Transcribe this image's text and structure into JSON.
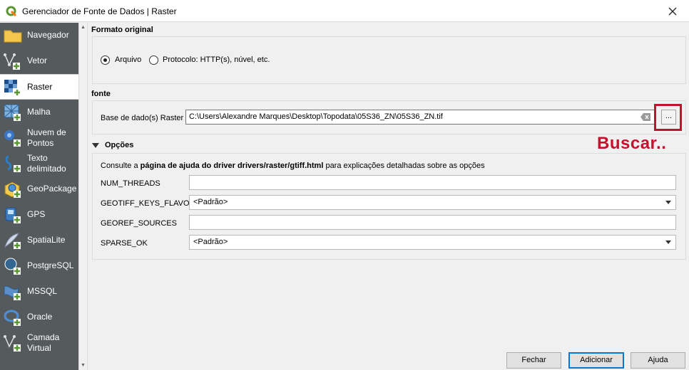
{
  "window": {
    "title": "Gerenciador de Fonte de Dados | Raster"
  },
  "sidebar": {
    "items": [
      {
        "label": "Navegador",
        "icon": "folder-icon"
      },
      {
        "label": "Vetor",
        "icon": "vector-icon"
      },
      {
        "label": "Raster",
        "icon": "raster-icon",
        "active": true
      },
      {
        "label": "Malha",
        "icon": "mesh-icon"
      },
      {
        "label": "Nuvem de Pontos",
        "line1": "Nuvem de",
        "line2": "Pontos",
        "icon": "point-cloud-icon"
      },
      {
        "label": "Texto delimitado",
        "line1": "Texto",
        "line2": "delimitado",
        "icon": "delimited-text-icon"
      },
      {
        "label": "GeoPackage",
        "icon": "geopackage-icon"
      },
      {
        "label": "GPS",
        "icon": "gps-icon"
      },
      {
        "label": "SpatiaLite",
        "icon": "spatialite-icon"
      },
      {
        "label": "PostgreSQL",
        "icon": "postgresql-icon"
      },
      {
        "label": "MSSQL",
        "icon": "mssql-icon"
      },
      {
        "label": "Oracle",
        "icon": "oracle-icon"
      },
      {
        "label": "Camada Virtual",
        "line1": "Camada",
        "line2": "Virtual",
        "icon": "virtual-layer-icon"
      }
    ]
  },
  "source_type": {
    "title": "Formato original",
    "options": [
      {
        "label": "Arquivo",
        "checked": true
      },
      {
        "label": "Protocolo: HTTP(s), núvel, etc.",
        "checked": false
      }
    ]
  },
  "source": {
    "title": "fonte",
    "label": "Base de dado(s) Raster",
    "path": "C:\\Users\\Alexandre Marques\\Desktop\\Topodata\\05S36_ZN\\05S36_ZN.tif",
    "browse_label": "..."
  },
  "annotation": {
    "text": "Buscar..",
    "color": "#c8102e"
  },
  "options": {
    "title": "Opções",
    "help_prefix": "Consulte a ",
    "help_link": "página de ajuda do driver drivers/raster/gtiff.html",
    "help_suffix": " para explicações detalhadas sobre as opções",
    "rows": [
      {
        "label": "NUM_THREADS",
        "kind": "text",
        "value": ""
      },
      {
        "label": "GEOTIFF_KEYS_FLAVOR",
        "kind": "combo",
        "value": "<Padrão>"
      },
      {
        "label": "GEOREF_SOURCES",
        "kind": "text",
        "value": ""
      },
      {
        "label": "SPARSE_OK",
        "kind": "combo",
        "value": "<Padrão>"
      }
    ]
  },
  "buttons": {
    "close": "Fechar",
    "add": "Adicionar",
    "help": "Ajuda"
  },
  "colors": {
    "sidebar_bg": "#555a5c",
    "accent": "#0078d7",
    "qgis_green": "#589632"
  }
}
